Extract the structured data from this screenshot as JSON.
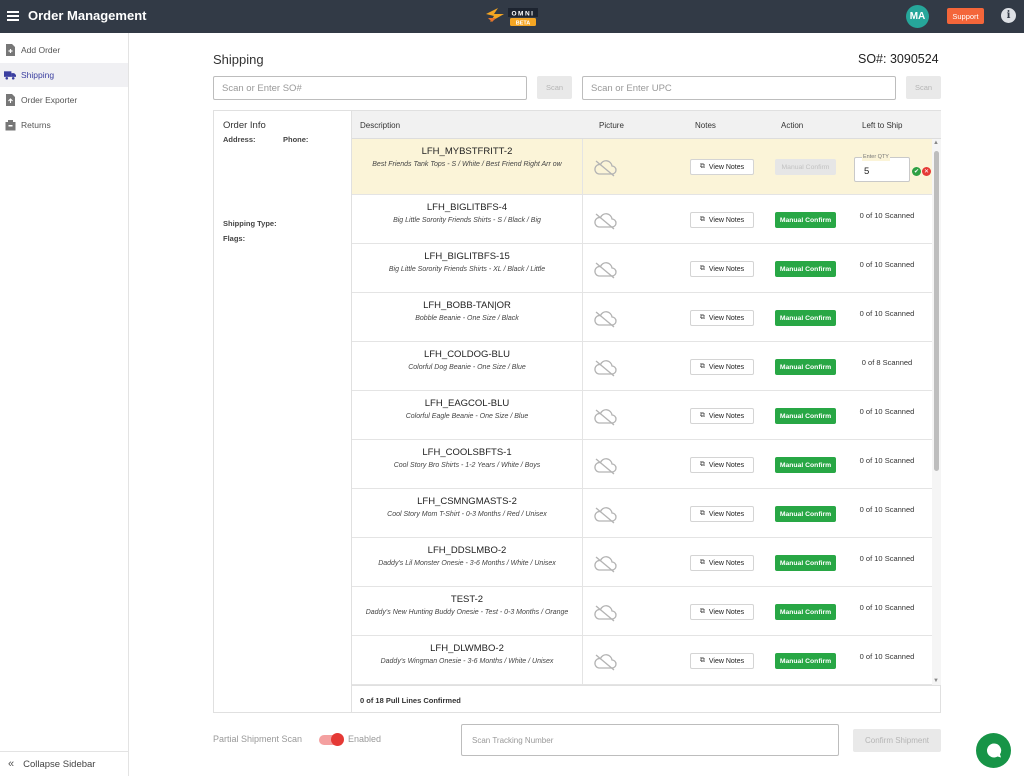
{
  "app": {
    "title": "Order Management",
    "logo_text": "OMNI",
    "logo_badge": "BETA",
    "avatar_initials": "MA",
    "support_label": "Support",
    "info_glyph": "i"
  },
  "sidebar": {
    "items": [
      {
        "label": "Add Order",
        "icon": "add-document-icon"
      },
      {
        "label": "Shipping",
        "icon": "truck-icon",
        "active": true
      },
      {
        "label": "Order Exporter",
        "icon": "export-document-icon"
      },
      {
        "label": "Returns",
        "icon": "box-return-icon"
      }
    ],
    "collapse_label": "Collapse Sidebar"
  },
  "page": {
    "title": "Shipping",
    "so_number": "SO#: 3090524",
    "so_placeholder": "Scan or Enter SO#",
    "upc_placeholder": "Scan or Enter UPC",
    "scan_label": "Scan"
  },
  "order_info": {
    "title": "Order Info",
    "address_label": "Address:",
    "phone_label": "Phone:",
    "shipping_type_label": "Shipping Type:",
    "flags_label": "Flags:"
  },
  "table": {
    "headers": {
      "description": "Description",
      "picture": "Picture",
      "notes": "Notes",
      "action": "Action",
      "left": "Left to Ship"
    },
    "view_notes_label": "View Notes",
    "manual_confirm_label": "Manual Confirm",
    "qty_label": "Enter QTY",
    "qty_value": "5",
    "rows": [
      {
        "sku": "LFH_MYBSTFRITT-2",
        "desc": "Best Friends Tank Tops - S / White / Best Friend Right Arr ow",
        "left": "",
        "selected": true
      },
      {
        "sku": "LFH_BIGLITBFS-4",
        "desc": "Big Little Sorority Friends Shirts - S / Black / Big",
        "left": "0 of 10 Scanned"
      },
      {
        "sku": "LFH_BIGLITBFS-15",
        "desc": "Big Little Sorority Friends Shirts - XL / Black / Little",
        "left": "0 of 10 Scanned"
      },
      {
        "sku": "LFH_BOBB-TAN|OR",
        "desc": "Bobble Beanie - One Size / Black",
        "left": "0 of 10 Scanned"
      },
      {
        "sku": "LFH_COLDOG-BLU",
        "desc": "Colorful Dog Beanie - One Size / Blue",
        "left": "0 of 8 Scanned"
      },
      {
        "sku": "LFH_EAGCOL-BLU",
        "desc": "Colorful Eagle Beanie - One Size / Blue",
        "left": "0 of 10 Scanned"
      },
      {
        "sku": "LFH_COOLSBFTS-1",
        "desc": "Cool Story Bro Shirts - 1-2 Years / White / Boys",
        "left": "0 of 10 Scanned"
      },
      {
        "sku": "LFH_CSMNGMASTS-2",
        "desc": "Cool Story Mom T-Shirt - 0-3 Months / Red / Unisex",
        "left": "0 of 10 Scanned"
      },
      {
        "sku": "LFH_DDSLMBO-2",
        "desc": "Daddy's Lil Monster Onesie - 3-6 Months / White / Unisex",
        "left": "0 of 10 Scanned"
      },
      {
        "sku": "TEST-2",
        "desc": "Daddy's New Hunting Buddy Onesie - Test - 0-3 Months / Orange",
        "left": "0 of 10 Scanned"
      },
      {
        "sku": "LFH_DLWMBO-2",
        "desc": "Daddy's Wingman Onesie - 3-6 Months / White / Unisex",
        "left": "0 of 10 Scanned"
      }
    ],
    "footer": "0 of 18 Pull Lines Confirmed"
  },
  "bottom": {
    "partial_label": "Partial Shipment Scan",
    "enabled_label": "Enabled",
    "tracking_placeholder": "Scan Tracking Number",
    "confirm_label": "Confirm Shipment"
  },
  "colors": {
    "topbar": "#323a46",
    "accent_green": "#28a745",
    "support": "#f4663a",
    "avatar": "#26a69a",
    "selected_row": "#fbf4d8",
    "toggle": "#e53935"
  }
}
